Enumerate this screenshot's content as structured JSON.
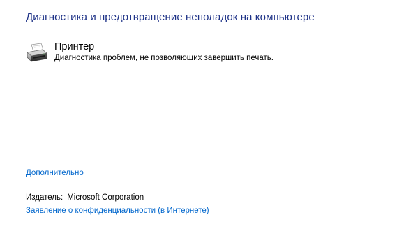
{
  "header": {
    "title": "Диагностика и предотвращение неполадок на компьютере"
  },
  "troubleshooter": {
    "title": "Принтер",
    "description": "Диагностика проблем, не позволяющих завершить печать.",
    "icon": "printer-icon"
  },
  "footer": {
    "advanced_label": "Дополнительно",
    "publisher_label": "Издатель:",
    "publisher_value": "Microsoft Corporation",
    "privacy_label": "Заявление о конфиденциальности (в Интернете)"
  },
  "colors": {
    "title": "#1e3287",
    "link": "#0066cc",
    "background": "#ffffff"
  }
}
